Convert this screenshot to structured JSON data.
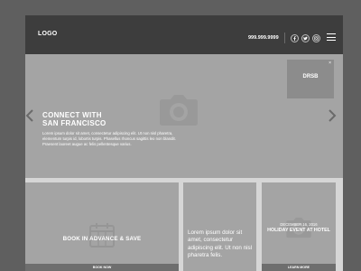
{
  "header": {
    "logo": "LOGO",
    "phone": "999.999.9999",
    "social_icons": [
      "facebook-icon",
      "twitter-icon",
      "instagram-icon"
    ],
    "menu_icon": "hamburger-menu-icon"
  },
  "hero": {
    "title_line1": "CONNECT WITH",
    "title_line2": "SAN FRANCISCO",
    "body": "Lorem ipsum dolor sit amet, consectetur adipiscing elit. Ut non nisl pharetra, elementum turpis id, lobortis turpis. Phasellus rhoncus sagittis leo non blandit. Praesent laoreet augue ac felis pellentesque varius.",
    "placeholder_icon": "camera-icon",
    "prev_icon": "chevron-left-icon",
    "next_icon": "chevron-right-icon",
    "popup": {
      "label": "DRSB",
      "close": "×"
    }
  },
  "cards": [
    {
      "title": "BOOK IN ADVANCE & SAVE",
      "button": "BOOK NOW",
      "icon": "calendar-icon"
    },
    {
      "text": "Lorem ipsum dolor sit amet, consectetur adipiscing elit. Ut non nisl pharetra felis."
    },
    {
      "date": "DECEMBER 16, 2016",
      "title": "HOLIDAY EVENT AT HOTEL",
      "button": "LEARN MORE",
      "icon": "camera-icon"
    }
  ],
  "colors": {
    "page_bg": "#5f5f5f",
    "header_bg": "#3d3d3d",
    "panel_bg": "#a4a4a4",
    "frame_bg": "#d6d6d6",
    "button_bg": "#6e6e6e",
    "text": "#ffffff"
  }
}
